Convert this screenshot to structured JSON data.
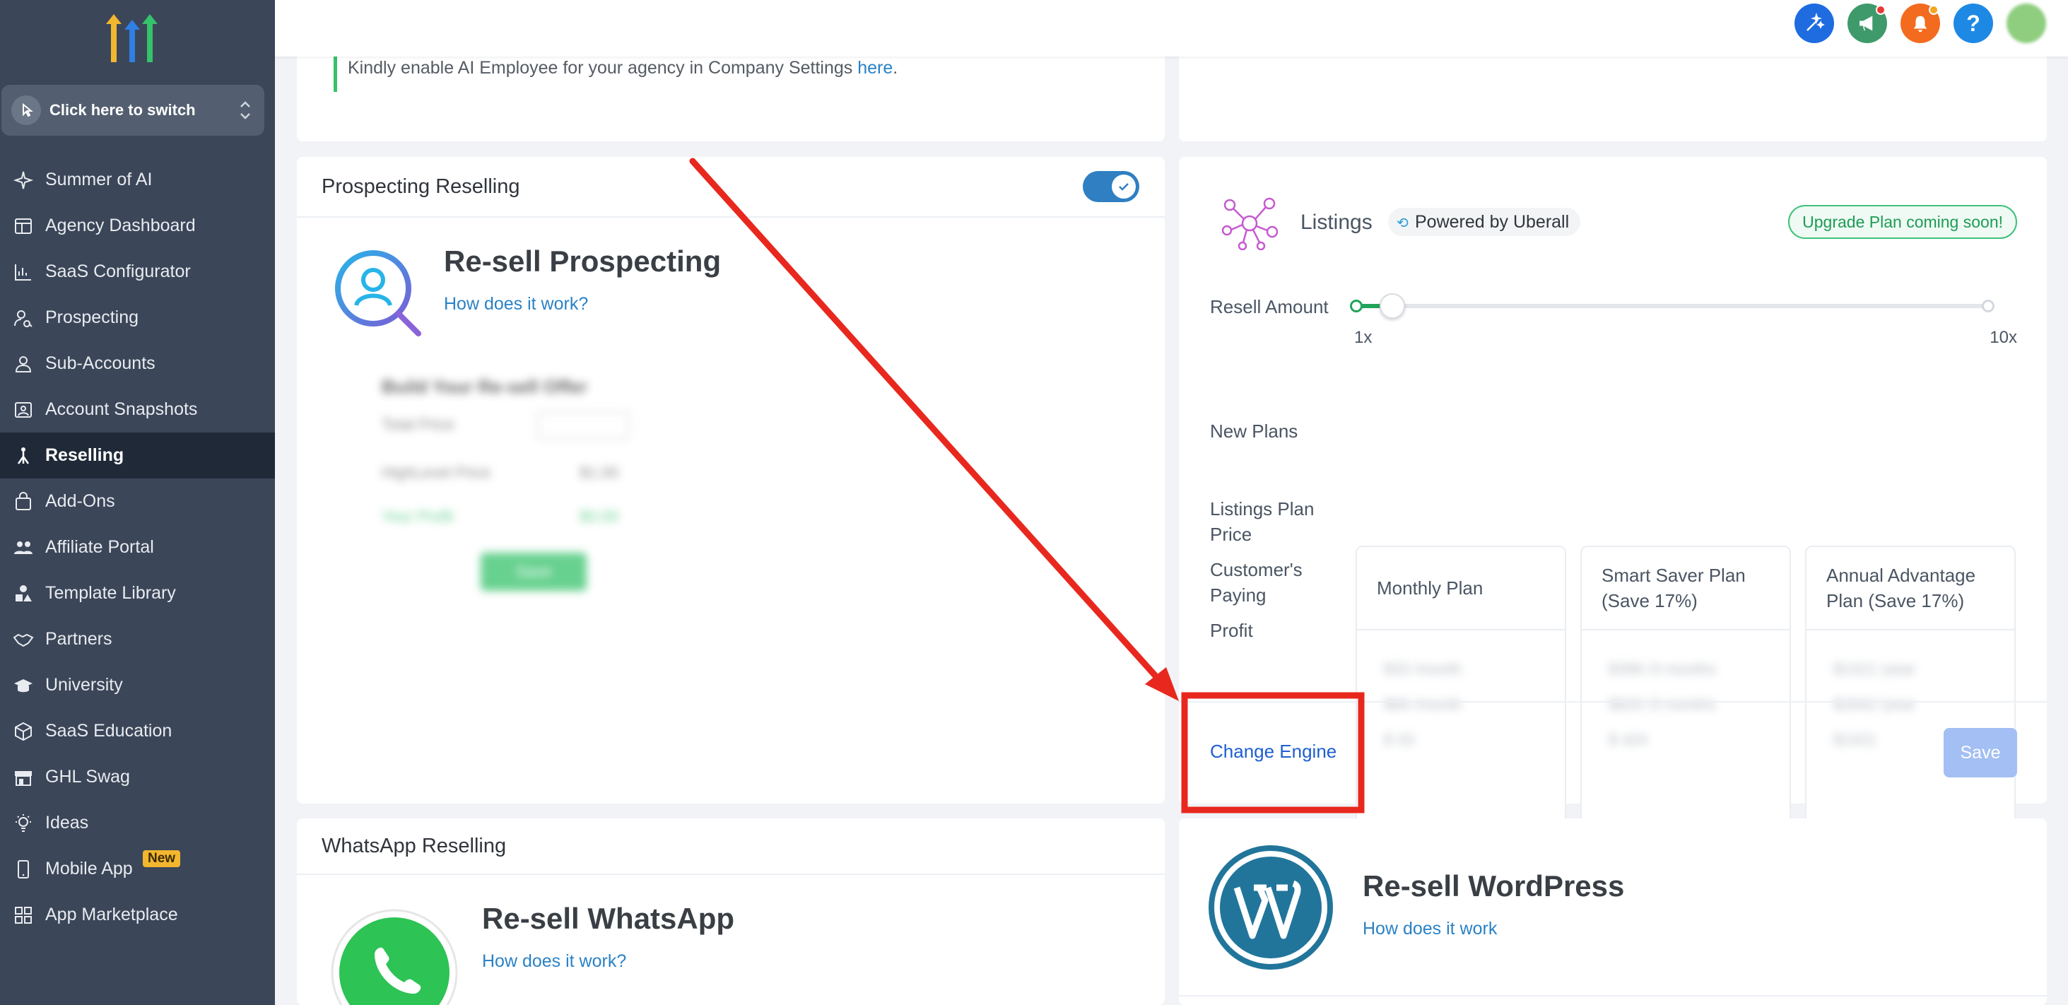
{
  "sidebar": {
    "switcher_label": "Click here to switch",
    "items": [
      {
        "label": "Summer of AI",
        "icon": "sparkle-icon"
      },
      {
        "label": "Agency Dashboard",
        "icon": "dashboard-icon"
      },
      {
        "label": "SaaS Configurator",
        "icon": "bar-chart-icon"
      },
      {
        "label": "Prospecting",
        "icon": "person-search-icon"
      },
      {
        "label": "Sub-Accounts",
        "icon": "user-icon"
      },
      {
        "label": "Account Snapshots",
        "icon": "snapshot-icon"
      },
      {
        "label": "Reselling",
        "icon": "reselling-icon"
      },
      {
        "label": "Add-Ons",
        "icon": "bag-icon"
      },
      {
        "label": "Affiliate Portal",
        "icon": "users-icon"
      },
      {
        "label": "Template Library",
        "icon": "shapes-icon"
      },
      {
        "label": "Partners",
        "icon": "handshake-icon"
      },
      {
        "label": "University",
        "icon": "graduation-cap-icon"
      },
      {
        "label": "SaaS Education",
        "icon": "box-icon"
      },
      {
        "label": "GHL Swag",
        "icon": "store-icon"
      },
      {
        "label": "Ideas",
        "icon": "lightbulb-icon"
      },
      {
        "label": "Mobile App",
        "icon": "phone-icon",
        "badge": "New"
      },
      {
        "label": "App Marketplace",
        "icon": "grid-icon"
      }
    ],
    "active_index": 6
  },
  "topbar": {
    "buttons": [
      "magic-wand-icon",
      "megaphone-icon",
      "bell-icon",
      "help-icon"
    ],
    "help_glyph": "?"
  },
  "ai_notice": {
    "text": "Kindly enable AI Employee for your agency in Company Settings ",
    "link": "here",
    "suffix": "."
  },
  "prospecting": {
    "header": "Prospecting Reselling",
    "title": "Re-sell Prospecting",
    "how": "How does it work?",
    "blur_title": "Build Your Re-sell Offer",
    "blur_rows": [
      "Total Price",
      "HighLevel Price",
      "Your Profit"
    ],
    "blur_vals": [
      "$0.00",
      "$1.00",
      "$0.00"
    ],
    "blur_button": "Save"
  },
  "listings": {
    "title": "Listings",
    "powered": "Powered by Uberall",
    "upgrade": "Upgrade Plan coming soon!",
    "resell_label": "Resell Amount",
    "slider_min": "1x",
    "slider_max": "10x",
    "slider_value": 0.06,
    "new_plans": "New Plans",
    "row_listings": "Listings Plan Price",
    "row_customers": "Customer's Paying",
    "row_profit": "Profit",
    "plans": [
      {
        "name": "Monthly Plan",
        "vals": [
          "$33 /month",
          "$66 /month",
          "$ 33"
        ]
      },
      {
        "name": "Smart Saver Plan (Save 17%)",
        "vals": [
          "$396 /3 months",
          "$820 /3 months",
          "$ 424"
        ]
      },
      {
        "name": "Annual Advantage Plan (Save 17%)",
        "vals": [
          "$1421 /year",
          "$2842 /year",
          "$1421"
        ]
      }
    ],
    "change_engine": "Change Engine",
    "save": "Save"
  },
  "whatsapp": {
    "header": "WhatsApp Reselling",
    "title": "Re-sell WhatsApp",
    "how": "How does it work?"
  },
  "wordpress": {
    "title": "Re-sell WordPress",
    "how": "How does it work"
  },
  "colors": {
    "sidebar": "#3b4658",
    "active": "#1f2937",
    "accent_blue": "#2a82c6",
    "annotation_red": "#e8281e",
    "slider_green": "#22a35a"
  }
}
